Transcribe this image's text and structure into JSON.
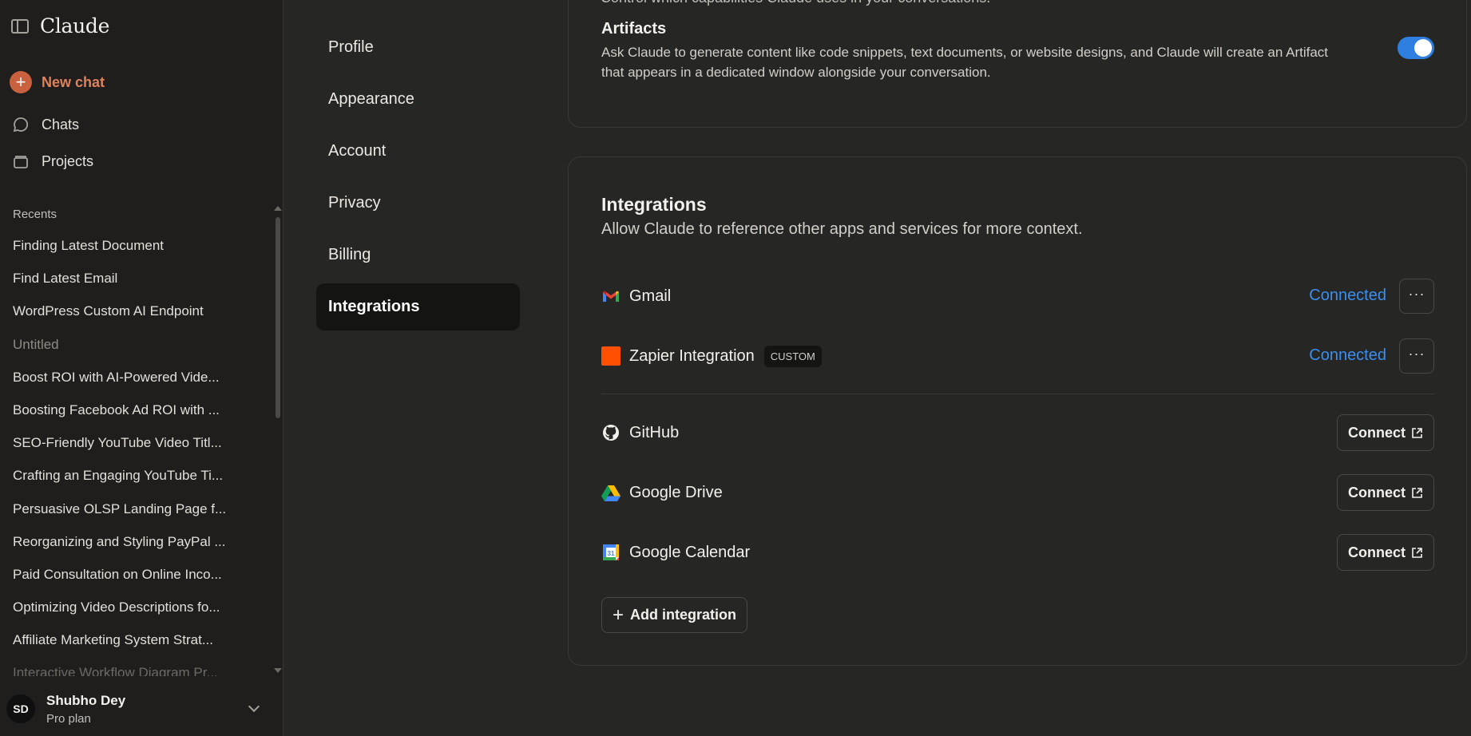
{
  "sidebar": {
    "brand": "Claude",
    "new_chat": "New chat",
    "chats": "Chats",
    "projects": "Projects",
    "recents_title": "Recents",
    "recents": [
      "Finding Latest Document",
      "Find Latest Email",
      "WordPress Custom AI Endpoint",
      "Untitled",
      "Boost ROI with AI-Powered Vide...",
      "Boosting Facebook Ad ROI with ...",
      "SEO-Friendly YouTube Video Titl...",
      "Crafting an Engaging YouTube Ti...",
      "Persuasive OLSP Landing Page f...",
      "Reorganizing and Styling PayPal ...",
      "Paid Consultation on Online Inco...",
      "Optimizing Video Descriptions fo...",
      "Affiliate Marketing System Strat...",
      "Interactive Workflow Diagram Pr..."
    ],
    "user": {
      "initials": "SD",
      "name": "Shubho Dey",
      "plan": "Pro plan"
    }
  },
  "settings_nav": {
    "items": [
      "Profile",
      "Appearance",
      "Account",
      "Privacy",
      "Billing",
      "Integrations"
    ],
    "active": "Integrations"
  },
  "artifacts": {
    "cut_text": "Control which capabilities Claude uses in your conversations.",
    "title": "Artifacts",
    "description": "Ask Claude to generate content like code snippets, text documents, or website designs, and Claude will create an Artifact that appears in a dedicated window alongside your conversation.",
    "enabled": true
  },
  "integrations": {
    "title": "Integrations",
    "subtitle": "Allow Claude to reference other apps and services for more context.",
    "connected": [
      {
        "name": "Gmail",
        "status": "Connected",
        "icon": "gmail-icon"
      },
      {
        "name": "Zapier Integration",
        "badge": "CUSTOM",
        "status": "Connected",
        "icon": "zapier-icon"
      }
    ],
    "available": [
      {
        "name": "GitHub",
        "action": "Connect",
        "icon": "github-icon"
      },
      {
        "name": "Google Drive",
        "action": "Connect",
        "icon": "google-drive-icon"
      },
      {
        "name": "Google Calendar",
        "action": "Connect",
        "icon": "google-calendar-icon"
      }
    ],
    "more_label": "···",
    "add_label": "Add integration"
  },
  "colors": {
    "accent_blue": "#3b8ff0",
    "new_chat_orange": "#e0825b",
    "toggle_on": "#2f7fe0",
    "zapier": "#ff4f00"
  }
}
